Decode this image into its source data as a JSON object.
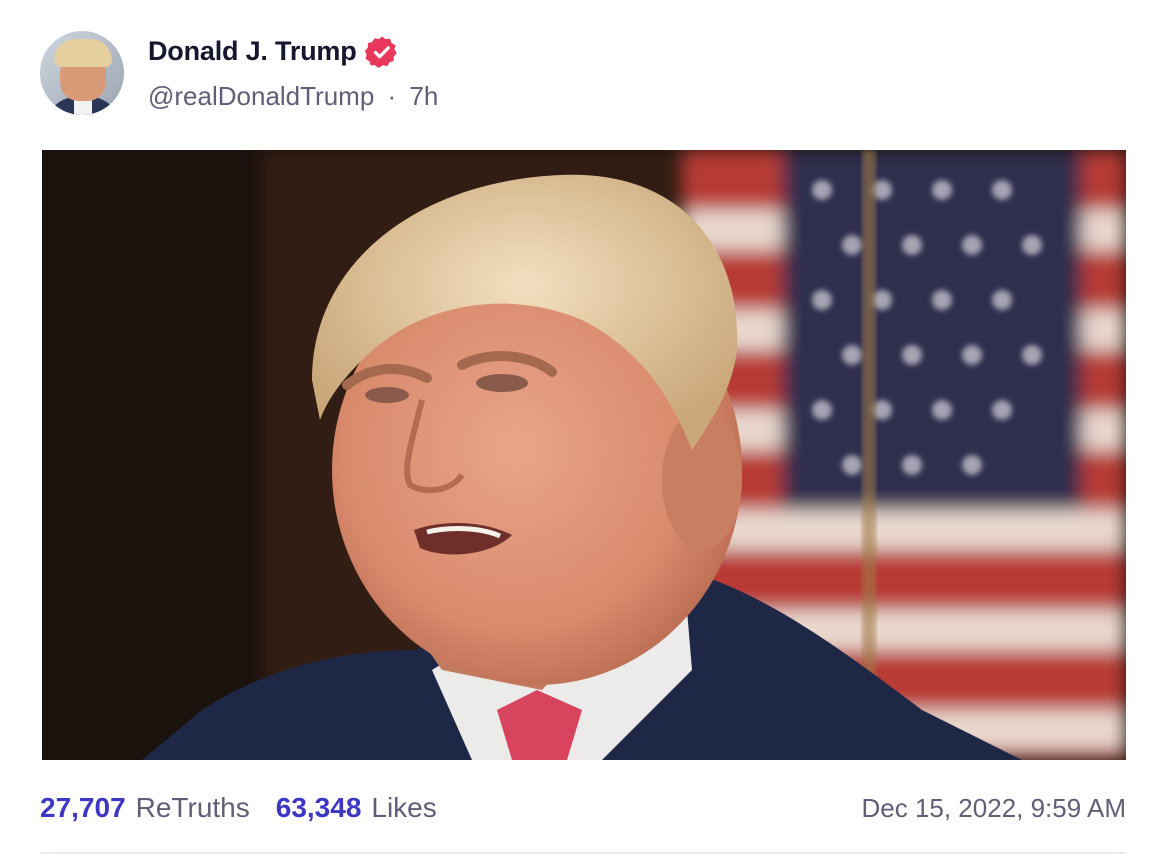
{
  "post": {
    "author": {
      "display_name": "Donald J. Trump",
      "handle": "@realDonaldTrump",
      "time_separator": "·",
      "time_ago": "7h",
      "verified_icon": "verified-badge-icon",
      "verified_color": "#e8395c"
    },
    "media": {
      "type": "photo"
    },
    "stats": {
      "retruths_count": "27,707",
      "retruths_label": "ReTruths",
      "likes_count": "63,348",
      "likes_label": "Likes",
      "accent_color": "#3d37c4"
    },
    "timestamp": "Dec 15, 2022, 9:59 AM"
  }
}
